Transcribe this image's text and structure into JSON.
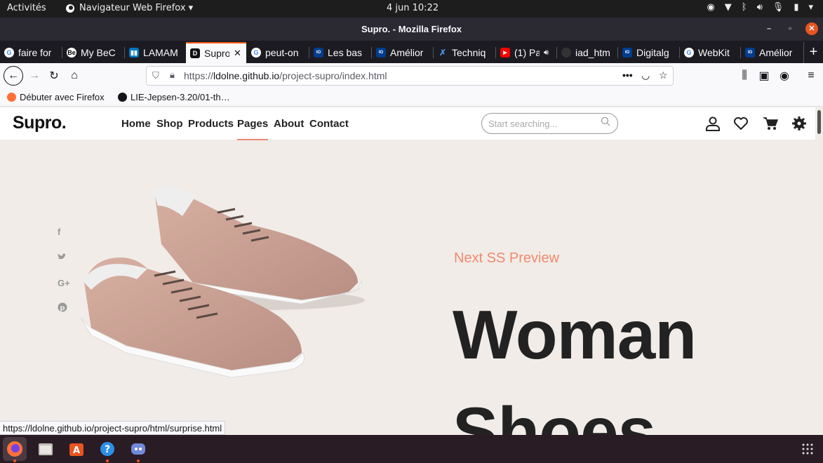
{
  "system_bar": {
    "activities": "Activités",
    "app_menu": "Navigateur Web Firefox ▾",
    "clock": "4 jun  10:22"
  },
  "window": {
    "title": "Supro. - Mozilla Firefox"
  },
  "tabs": [
    {
      "label": "faire for",
      "favicon": "google-icon",
      "color": "#4285f4"
    },
    {
      "label": "My BeC",
      "favicon": "behance-icon",
      "color": "#ffffff"
    },
    {
      "label": "LAMAM",
      "favicon": "trello-icon",
      "color": "#0079bf"
    },
    {
      "label": "Supro",
      "favicon": "d-icon",
      "color": "#111111"
    },
    {
      "label": "peut-on",
      "favicon": "google-icon",
      "color": "#4285f4"
    },
    {
      "label": "Les bas",
      "favicon": "ionos-icon",
      "color": "#003d8f"
    },
    {
      "label": "Amélior",
      "favicon": "ionos-icon",
      "color": "#003d8f"
    },
    {
      "label": "Techniq",
      "favicon": "x-icon",
      "color": "#4a90d9"
    },
    {
      "label": "(1) Pa",
      "favicon": "youtube-icon",
      "color": "#ff0000"
    },
    {
      "label": "iad_htm",
      "favicon": "github-icon",
      "color": "#444444"
    },
    {
      "label": "Digitalg",
      "favicon": "ionos-icon",
      "color": "#003d8f"
    },
    {
      "label": "WebKit",
      "favicon": "google-icon",
      "color": "#4285f4"
    },
    {
      "label": "Amélior",
      "favicon": "ionos-icon",
      "color": "#003d8f"
    }
  ],
  "address_bar": {
    "url_prefix": "https://",
    "url_host": "ldolne.github.io",
    "url_path": "/project-supro/index.html"
  },
  "bookmarks": [
    {
      "label": "Débuter avec Firefox",
      "icon": "firefox-icon"
    },
    {
      "label": "LIE-Jepsen-3.20/01-th…",
      "icon": "github-icon"
    }
  ],
  "site": {
    "logo": "Supro.",
    "nav": [
      "Home",
      "Shop",
      "Products",
      "Pages",
      "About",
      "Contact"
    ],
    "active_nav": "Pages",
    "search_placeholder": "Start searching...",
    "social": [
      "f",
      "t",
      "G+",
      "p"
    ],
    "preview_label": "Next SS Preview",
    "headline_line1": "Woman",
    "headline_line2": "Shoes",
    "accent_color": "#f08a6e"
  },
  "status_bar": {
    "hover_url": "https://ldolne.github.io/project-supro/html/surprise.html"
  }
}
